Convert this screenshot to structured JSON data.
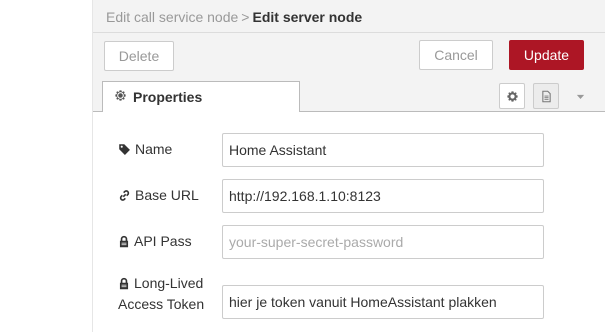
{
  "breadcrumb": {
    "previous": "Edit call service node",
    "separator": ">",
    "current": "Edit server node"
  },
  "toolbar": {
    "delete_label": "Delete",
    "cancel_label": "Cancel",
    "update_label": "Update"
  },
  "tabs": {
    "properties_label": "Properties"
  },
  "form": {
    "name_label": "Name",
    "name_value": "Home Assistant",
    "base_url_label": "Base URL",
    "base_url_value": "http://192.168.1.10:8123",
    "api_pass_label": "API Pass",
    "api_pass_placeholder": "your-super-secret-password",
    "api_pass_value": "",
    "token_label_line1": "Long-Lived",
    "token_label_line2": "Access Token",
    "token_value": "hier je token vanuit HomeAssistant plakken"
  },
  "icons": {
    "properties": "gear-icon",
    "name": "tag-icon",
    "base_url": "link-icon",
    "api_pass": "lock-icon",
    "token": "lock-icon",
    "tab_settings": "gear-icon",
    "tab_description": "document-icon",
    "tab_more": "caret-down-icon"
  },
  "colors": {
    "accent": "#ad1625",
    "background": "#f3f3f3"
  }
}
